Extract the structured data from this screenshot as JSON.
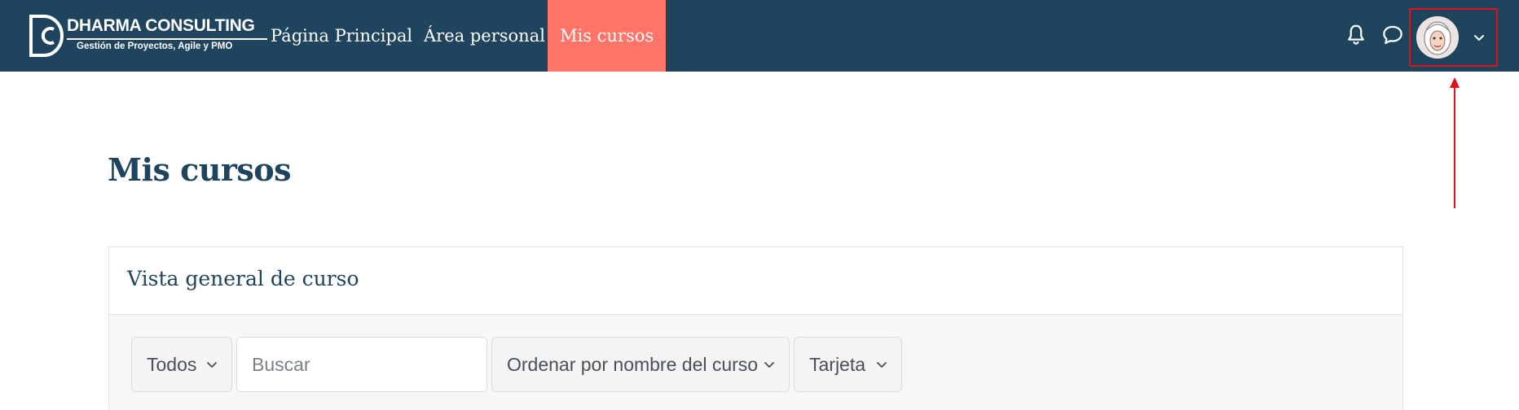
{
  "header": {
    "brand": {
      "title": "DHARMA CONSULTING",
      "subtitle": "Gestión de Proyectos, Agile y PMO"
    },
    "nav": [
      {
        "label": "Página Principal"
      },
      {
        "label": "Área personal"
      },
      {
        "label": "Mis cursos",
        "active": true
      }
    ],
    "icons": {
      "notifications": "bell-icon",
      "messages": "chat-bubble-icon",
      "user_menu_caret": "chevron-down-icon"
    },
    "colors": {
      "navbar": "#1e445e",
      "active_tab": "#ff7468",
      "highlight_box": "#e0111b"
    }
  },
  "main": {
    "page_title": "Mis cursos",
    "overview": {
      "title": "Vista general de curso",
      "filter_selected": "Todos",
      "search_placeholder": "Buscar",
      "sort_selected": "Ordenar por nombre del curso",
      "view_selected": "Tarjeta"
    }
  }
}
